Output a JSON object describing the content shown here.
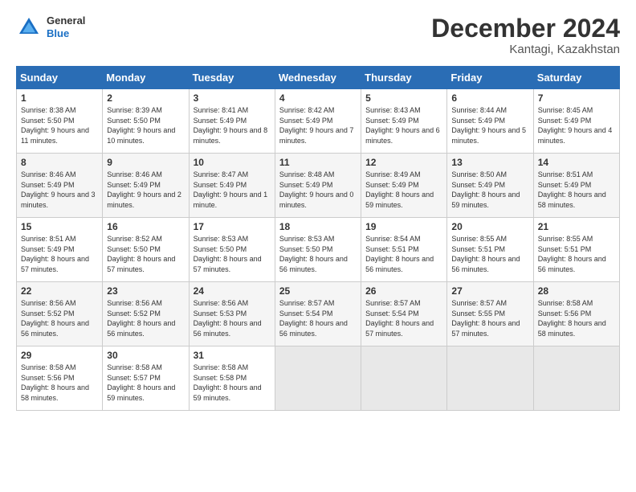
{
  "header": {
    "logo_general": "General",
    "logo_blue": "Blue",
    "month_title": "December 2024",
    "location": "Kantagi, Kazakhstan"
  },
  "days_of_week": [
    "Sunday",
    "Monday",
    "Tuesday",
    "Wednesday",
    "Thursday",
    "Friday",
    "Saturday"
  ],
  "weeks": [
    [
      {
        "day": "1",
        "info": "Sunrise: 8:38 AM\nSunset: 5:50 PM\nDaylight: 9 hours and 11 minutes."
      },
      {
        "day": "2",
        "info": "Sunrise: 8:39 AM\nSunset: 5:50 PM\nDaylight: 9 hours and 10 minutes."
      },
      {
        "day": "3",
        "info": "Sunrise: 8:41 AM\nSunset: 5:49 PM\nDaylight: 9 hours and 8 minutes."
      },
      {
        "day": "4",
        "info": "Sunrise: 8:42 AM\nSunset: 5:49 PM\nDaylight: 9 hours and 7 minutes."
      },
      {
        "day": "5",
        "info": "Sunrise: 8:43 AM\nSunset: 5:49 PM\nDaylight: 9 hours and 6 minutes."
      },
      {
        "day": "6",
        "info": "Sunrise: 8:44 AM\nSunset: 5:49 PM\nDaylight: 9 hours and 5 minutes."
      },
      {
        "day": "7",
        "info": "Sunrise: 8:45 AM\nSunset: 5:49 PM\nDaylight: 9 hours and 4 minutes."
      }
    ],
    [
      {
        "day": "8",
        "info": "Sunrise: 8:46 AM\nSunset: 5:49 PM\nDaylight: 9 hours and 3 minutes."
      },
      {
        "day": "9",
        "info": "Sunrise: 8:46 AM\nSunset: 5:49 PM\nDaylight: 9 hours and 2 minutes."
      },
      {
        "day": "10",
        "info": "Sunrise: 8:47 AM\nSunset: 5:49 PM\nDaylight: 9 hours and 1 minute."
      },
      {
        "day": "11",
        "info": "Sunrise: 8:48 AM\nSunset: 5:49 PM\nDaylight: 9 hours and 0 minutes."
      },
      {
        "day": "12",
        "info": "Sunrise: 8:49 AM\nSunset: 5:49 PM\nDaylight: 8 hours and 59 minutes."
      },
      {
        "day": "13",
        "info": "Sunrise: 8:50 AM\nSunset: 5:49 PM\nDaylight: 8 hours and 59 minutes."
      },
      {
        "day": "14",
        "info": "Sunrise: 8:51 AM\nSunset: 5:49 PM\nDaylight: 8 hours and 58 minutes."
      }
    ],
    [
      {
        "day": "15",
        "info": "Sunrise: 8:51 AM\nSunset: 5:49 PM\nDaylight: 8 hours and 57 minutes."
      },
      {
        "day": "16",
        "info": "Sunrise: 8:52 AM\nSunset: 5:50 PM\nDaylight: 8 hours and 57 minutes."
      },
      {
        "day": "17",
        "info": "Sunrise: 8:53 AM\nSunset: 5:50 PM\nDaylight: 8 hours and 57 minutes."
      },
      {
        "day": "18",
        "info": "Sunrise: 8:53 AM\nSunset: 5:50 PM\nDaylight: 8 hours and 56 minutes."
      },
      {
        "day": "19",
        "info": "Sunrise: 8:54 AM\nSunset: 5:51 PM\nDaylight: 8 hours and 56 minutes."
      },
      {
        "day": "20",
        "info": "Sunrise: 8:55 AM\nSunset: 5:51 PM\nDaylight: 8 hours and 56 minutes."
      },
      {
        "day": "21",
        "info": "Sunrise: 8:55 AM\nSunset: 5:51 PM\nDaylight: 8 hours and 56 minutes."
      }
    ],
    [
      {
        "day": "22",
        "info": "Sunrise: 8:56 AM\nSunset: 5:52 PM\nDaylight: 8 hours and 56 minutes."
      },
      {
        "day": "23",
        "info": "Sunrise: 8:56 AM\nSunset: 5:52 PM\nDaylight: 8 hours and 56 minutes."
      },
      {
        "day": "24",
        "info": "Sunrise: 8:56 AM\nSunset: 5:53 PM\nDaylight: 8 hours and 56 minutes."
      },
      {
        "day": "25",
        "info": "Sunrise: 8:57 AM\nSunset: 5:54 PM\nDaylight: 8 hours and 56 minutes."
      },
      {
        "day": "26",
        "info": "Sunrise: 8:57 AM\nSunset: 5:54 PM\nDaylight: 8 hours and 57 minutes."
      },
      {
        "day": "27",
        "info": "Sunrise: 8:57 AM\nSunset: 5:55 PM\nDaylight: 8 hours and 57 minutes."
      },
      {
        "day": "28",
        "info": "Sunrise: 8:58 AM\nSunset: 5:56 PM\nDaylight: 8 hours and 58 minutes."
      }
    ],
    [
      {
        "day": "29",
        "info": "Sunrise: 8:58 AM\nSunset: 5:56 PM\nDaylight: 8 hours and 58 minutes."
      },
      {
        "day": "30",
        "info": "Sunrise: 8:58 AM\nSunset: 5:57 PM\nDaylight: 8 hours and 59 minutes."
      },
      {
        "day": "31",
        "info": "Sunrise: 8:58 AM\nSunset: 5:58 PM\nDaylight: 8 hours and 59 minutes."
      },
      null,
      null,
      null,
      null
    ]
  ]
}
